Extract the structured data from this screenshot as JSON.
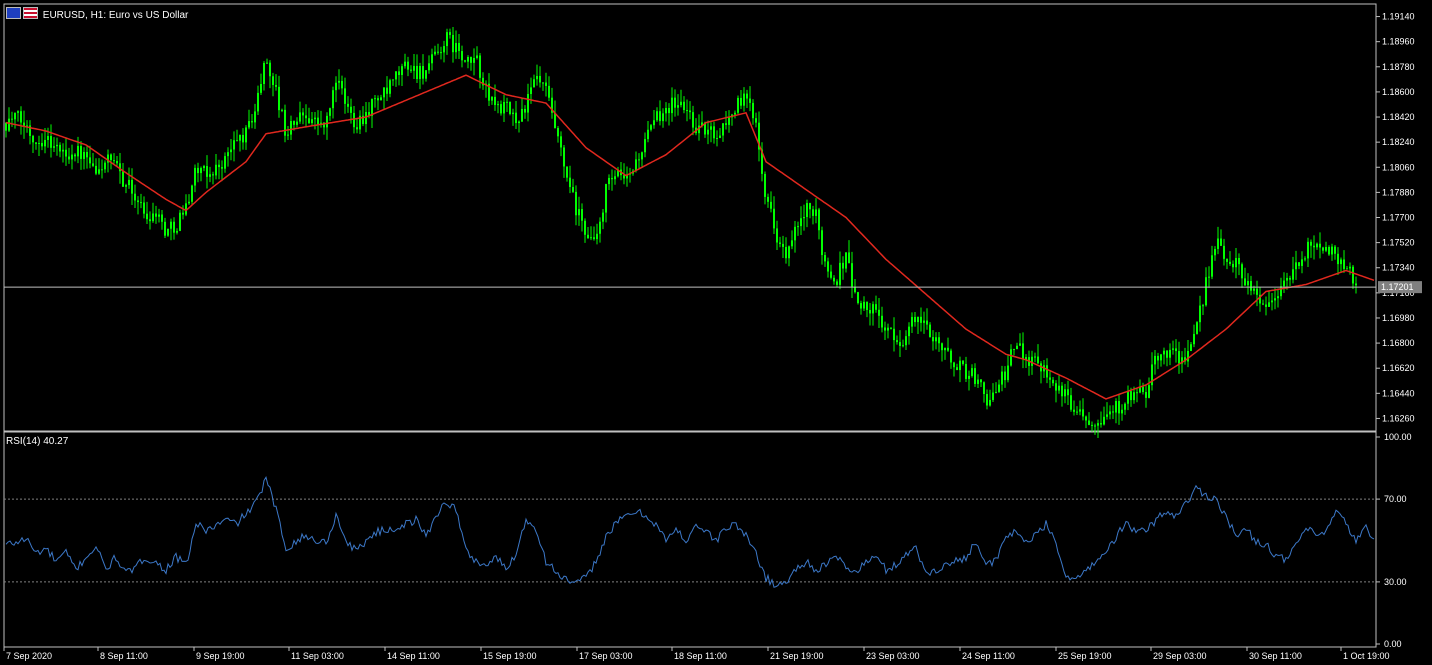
{
  "header": {
    "title": "EURUSD, H1:  Euro vs US Dollar",
    "rsi_label": "RSI(14) 40.27"
  },
  "colors": {
    "background": "#000000",
    "frame": "#c0c0c0",
    "candle": "#00ff00",
    "ma_line": "#e0281e",
    "rsi_line": "#3c78c8",
    "level_line": "#808080",
    "axis_text": "#ffffff",
    "price_tag_bg": "#808080"
  },
  "chart_data": [
    {
      "type": "candlestick",
      "title": "EURUSD, H1:  Euro vs US Dollar",
      "xlabel": "",
      "ylabel": "",
      "ylim": [
        1.1617,
        1.1923
      ],
      "y_ticks": [
        "1.19140",
        "1.18960",
        "1.18780",
        "1.18600",
        "1.18420",
        "1.18240",
        "1.18060",
        "1.17880",
        "1.17700",
        "1.17520",
        "1.17340",
        "1.17160",
        "1.16980",
        "1.16800",
        "1.16620",
        "1.16440",
        "1.16260"
      ],
      "x_ticks": [
        "7 Sep 2020",
        "8 Sep 11:00",
        "9 Sep 19:00",
        "11 Sep 03:00",
        "14 Sep 11:00",
        "15 Sep 19:00",
        "17 Sep 03:00",
        "18 Sep 11:00",
        "21 Sep 19:00",
        "23 Sep 03:00",
        "24 Sep 11:00",
        "25 Sep 19:00",
        "29 Sep 03:00",
        "30 Sep 11:00",
        "1 Oct 19:00"
      ],
      "current_price": "1.17201",
      "close_series": {
        "x_index": [
          0,
          10,
          20,
          30,
          40,
          50,
          60,
          70,
          80,
          90,
          100,
          110,
          120,
          130,
          140,
          150,
          160,
          170,
          180,
          190,
          200,
          210,
          220,
          230,
          240,
          250,
          260,
          270,
          280,
          290,
          300,
          310,
          320,
          330,
          340,
          350,
          360,
          370,
          380,
          390,
          400,
          410,
          420,
          430,
          440,
          450,
          460,
          470,
          480,
          490,
          500,
          510,
          520,
          530,
          540,
          550,
          560,
          570,
          580,
          590,
          600,
          610,
          620,
          630,
          640,
          650,
          660,
          670,
          680,
          690,
          700,
          710,
          720,
          730,
          740,
          750,
          760,
          770,
          780,
          790,
          800,
          810,
          820,
          830,
          840,
          850,
          860,
          870,
          880,
          890,
          900,
          910,
          920,
          930,
          940,
          950,
          960,
          970,
          980,
          990,
          1000,
          1010,
          1020,
          1030,
          1040,
          1050,
          1060,
          1070,
          1080,
          1090,
          1100,
          1110,
          1120,
          1130,
          1140,
          1150,
          1160,
          1170,
          1180,
          1190,
          1200,
          1210,
          1220,
          1230,
          1240,
          1250,
          1260,
          1270,
          1280,
          1290,
          1300,
          1310,
          1320,
          1330,
          1340,
          1350,
          1360,
          1368
        ],
        "values": [
          1.1838,
          1.1842,
          1.1835,
          1.1825,
          1.1828,
          1.182,
          1.1815,
          1.1818,
          1.1812,
          1.18,
          1.1812,
          1.1805,
          1.1795,
          1.1785,
          1.177,
          1.1775,
          1.176,
          1.1765,
          1.1778,
          1.1805,
          1.18,
          1.1805,
          1.1812,
          1.1825,
          1.183,
          1.185,
          1.1885,
          1.186,
          1.183,
          1.184,
          1.1845,
          1.1838,
          1.1835,
          1.187,
          1.185,
          1.1838,
          1.1845,
          1.1855,
          1.1858,
          1.187,
          1.188,
          1.1875,
          1.1875,
          1.1885,
          1.1898,
          1.1892,
          1.1878,
          1.1885,
          1.186,
          1.185,
          1.1848,
          1.184,
          1.185,
          1.187,
          1.186,
          1.183,
          1.18,
          1.1775,
          1.176,
          1.175,
          1.179,
          1.18,
          1.1795,
          1.181,
          1.1825,
          1.184,
          1.185,
          1.1852,
          1.1848,
          1.1835,
          1.1832,
          1.183,
          1.1838,
          1.185,
          1.1855,
          1.184,
          1.1785,
          1.176,
          1.174,
          1.176,
          1.1775,
          1.177,
          1.1735,
          1.1725,
          1.1745,
          1.171,
          1.1705,
          1.1702,
          1.169,
          1.168,
          1.1685,
          1.17,
          1.169,
          1.1685,
          1.1672,
          1.1665,
          1.166,
          1.1655,
          1.164,
          1.1645,
          1.166,
          1.168,
          1.167,
          1.1668,
          1.1662,
          1.165,
          1.164,
          1.1635,
          1.1628,
          1.1625,
          1.163,
          1.1633,
          1.164,
          1.1642,
          1.1645,
          1.1668,
          1.1675,
          1.1672,
          1.1668,
          1.1685,
          1.1725,
          1.1752,
          1.174,
          1.1738,
          1.1725,
          1.1716,
          1.1705,
          1.1715,
          1.1725,
          1.1733,
          1.1745,
          1.1755,
          1.1747,
          1.1743,
          1.1735,
          1.1722
        ]
      },
      "moving_average": {
        "x_index": [
          0,
          40,
          80,
          120,
          160,
          180,
          200,
          240,
          260,
          300,
          360,
          420,
          460,
          500,
          540,
          580,
          620,
          660,
          700,
          740,
          760,
          800,
          840,
          880,
          920,
          960,
          1000,
          1020,
          1060,
          1100,
          1140,
          1180,
          1220,
          1260,
          1300,
          1340,
          1368
        ],
        "values": [
          1.1838,
          1.1832,
          1.1822,
          1.1802,
          1.1783,
          1.1775,
          1.1788,
          1.181,
          1.183,
          1.1835,
          1.1842,
          1.186,
          1.1872,
          1.1858,
          1.1852,
          1.182,
          1.18,
          1.1815,
          1.1838,
          1.1845,
          1.181,
          1.179,
          1.177,
          1.174,
          1.1715,
          1.169,
          1.1672,
          1.1668,
          1.1655,
          1.164,
          1.165,
          1.1668,
          1.169,
          1.1717,
          1.1722,
          1.1732,
          1.1725
        ]
      }
    },
    {
      "type": "line",
      "title": "RSI(14) 40.27",
      "xlabel": "",
      "ylabel": "",
      "ylim": [
        0,
        100
      ],
      "y_ticks": [
        "100.00",
        "70.00",
        "30.00",
        "0.00"
      ],
      "levels": [
        70,
        30
      ],
      "series": [
        {
          "x_index": [
            0,
            10,
            20,
            30,
            40,
            50,
            60,
            70,
            80,
            90,
            100,
            110,
            120,
            130,
            140,
            150,
            160,
            170,
            180,
            190,
            200,
            210,
            220,
            230,
            240,
            250,
            260,
            270,
            280,
            290,
            300,
            310,
            320,
            330,
            340,
            350,
            360,
            370,
            380,
            390,
            400,
            410,
            420,
            430,
            440,
            450,
            460,
            470,
            480,
            490,
            500,
            510,
            520,
            530,
            540,
            550,
            560,
            570,
            580,
            590,
            600,
            610,
            620,
            630,
            640,
            650,
            660,
            670,
            680,
            690,
            700,
            710,
            720,
            730,
            740,
            750,
            760,
            770,
            780,
            790,
            800,
            810,
            820,
            830,
            840,
            850,
            860,
            870,
            880,
            890,
            900,
            910,
            920,
            930,
            940,
            950,
            960,
            970,
            980,
            990,
            1000,
            1010,
            1020,
            1030,
            1040,
            1050,
            1060,
            1070,
            1080,
            1090,
            1100,
            1110,
            1120,
            1130,
            1140,
            1150,
            1160,
            1170,
            1180,
            1190,
            1200,
            1210,
            1220,
            1230,
            1240,
            1250,
            1260,
            1270,
            1280,
            1290,
            1300,
            1310,
            1320,
            1330,
            1340,
            1350,
            1360,
            1368
          ],
          "values": [
            48,
            49,
            51,
            44,
            46,
            40,
            44,
            36,
            42,
            47,
            36,
            42,
            34,
            37,
            42,
            39,
            36,
            42,
            38,
            58,
            55,
            57,
            60,
            58,
            63,
            68,
            80,
            65,
            46,
            50,
            52,
            50,
            49,
            62,
            50,
            45,
            50,
            54,
            55,
            56,
            58,
            60,
            52,
            62,
            69,
            65,
            45,
            40,
            38,
            42,
            36,
            44,
            60,
            56,
            40,
            35,
            31,
            29,
            32,
            40,
            52,
            58,
            62,
            64,
            62,
            58,
            50,
            55,
            50,
            58,
            54,
            50,
            56,
            58,
            52,
            44,
            32,
            28,
            30,
            36,
            40,
            36,
            38,
            42,
            38,
            34,
            40,
            42,
            36,
            38,
            44,
            46,
            34,
            36,
            38,
            40,
            42,
            50,
            38,
            40,
            52,
            54,
            50,
            52,
            58,
            48,
            34,
            30,
            36,
            40,
            44,
            52,
            58,
            54,
            55,
            60,
            64,
            62,
            68,
            75,
            72,
            70,
            62,
            52,
            55,
            50,
            48,
            43,
            40,
            48,
            56,
            52,
            54,
            64,
            58,
            50,
            56,
            50,
            40
          ]
        }
      ]
    }
  ]
}
